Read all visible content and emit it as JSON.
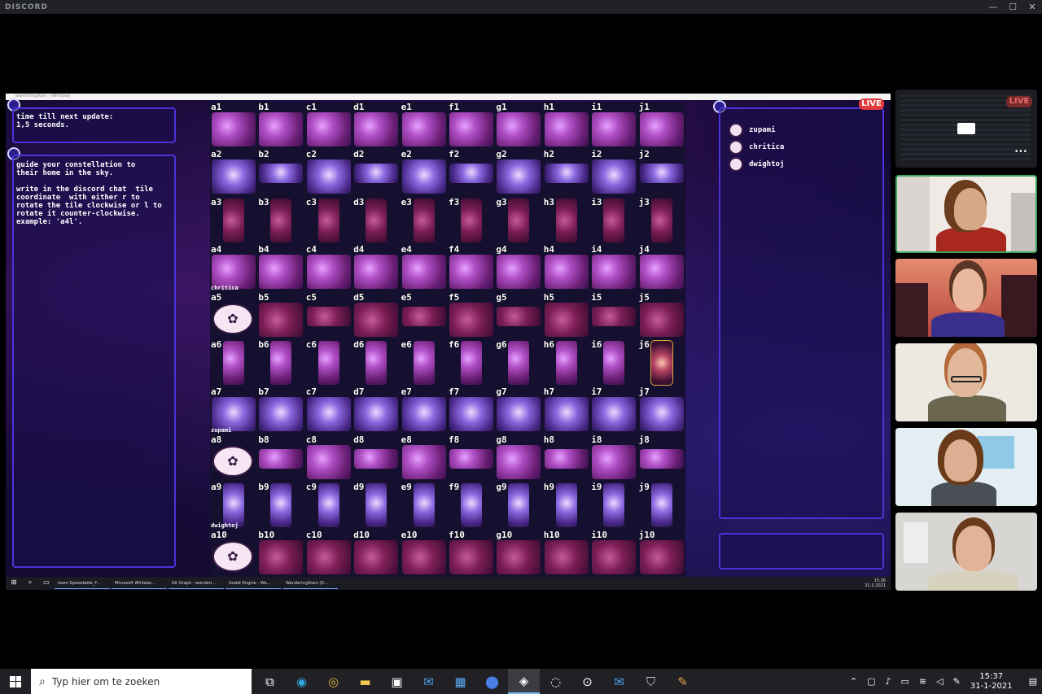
{
  "window": {
    "app_name": "DISCORD",
    "min": "—",
    "max": "☐",
    "close": "✕"
  },
  "stream": {
    "live_label": "LIVE",
    "chrome_title": "wanderingstars - [Window]"
  },
  "game": {
    "timer_text": "time till next update:\n1,5 seconds.",
    "instructions": "guide your constellation to\ntheir home in the sky.\n\nwrite in the discord chat  tile\ncoordinate  with either r to\nrotate the tile clockwise or l to\nrotate it counter-clockwise.\nexample: 'a4l'.",
    "columns": [
      "a",
      "b",
      "c",
      "d",
      "e",
      "f",
      "g",
      "h",
      "i",
      "j"
    ],
    "rows": [
      "1",
      "2",
      "3",
      "4",
      "5",
      "6",
      "7",
      "8",
      "9",
      "10"
    ],
    "highlight_cell": "j6",
    "player_markers": [
      {
        "name": "chritica",
        "cell": "a5"
      },
      {
        "name": "zupami",
        "cell": "a8"
      },
      {
        "name": "dwightoj",
        "cell": "a10"
      }
    ],
    "players": [
      "zupami",
      "chritica",
      "dwightoj"
    ]
  },
  "inner_taskbar": {
    "items": [
      "team Spreadable_F...",
      "Microsoft Whitebo...",
      "Git Graph - wanderi...",
      "Godot Engine - Wa...",
      "WanderingStars (D..."
    ],
    "clock_time": "15:36",
    "clock_date": "31-1-2021"
  },
  "video_tiles": {
    "live_label": "LIVE",
    "more_label": "•••",
    "camera_icon": "camera-icon"
  },
  "taskbar": {
    "search_placeholder": "Typ hier om te zoeken",
    "time": "15:37",
    "date": "31-1-2021",
    "apps": [
      "task-view-icon",
      "edge-icon",
      "chrome-icon",
      "file-explorer-icon",
      "store-icon",
      "mail-icon",
      "calendar-icon",
      "maps-icon",
      "discord-icon",
      "app-icon",
      "app2-icon",
      "mail2-icon",
      "shield-icon",
      "paint-icon"
    ],
    "colors": {
      "accent": "#76b9ed",
      "bg": "#202025"
    }
  }
}
